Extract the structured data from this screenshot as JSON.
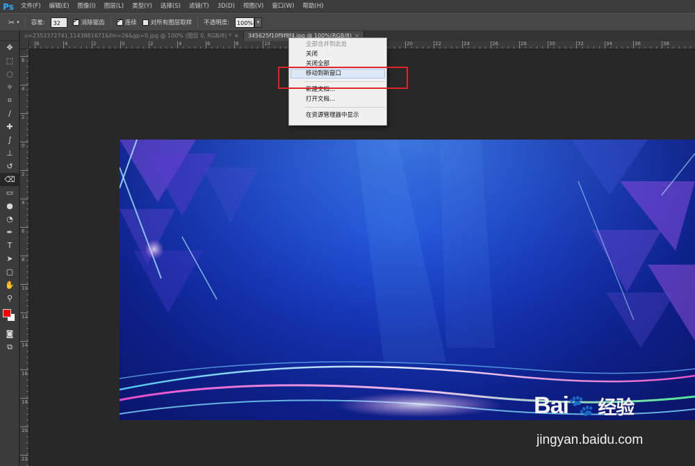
{
  "app": {
    "logo": "Ps",
    "menus": [
      "文件(F)",
      "编辑(E)",
      "图像(I)",
      "图层(L)",
      "类型(Y)",
      "选择(S)",
      "滤镜(T)",
      "3D(D)",
      "视图(V)",
      "窗口(W)",
      "帮助(H)"
    ]
  },
  "options": {
    "tolerance_label": "容差:",
    "tolerance_value": "32",
    "antialias_label": "消除锯齿",
    "contiguous_label": "连续",
    "sample_all_label": "对所有图层取样",
    "opacity_label": "不透明度:",
    "opacity_value": "100%"
  },
  "tabs": [
    {
      "label": "u=2353372741,1143881671&fm=26&gp=0.jpg @ 100% (图层 0, RGB/8) *",
      "close": "×",
      "active": false
    },
    {
      "label": "345625f10f9f8f4.jpg @ 100%(RGB/8)",
      "close": "×",
      "active": true
    }
  ],
  "ruler_top_labels": [
    "6",
    "4",
    "2",
    "0",
    "2",
    "4",
    "6",
    "8",
    "10",
    "12",
    "14",
    "16",
    "18",
    "20",
    "22",
    "24",
    "26",
    "28",
    "30",
    "32",
    "34",
    "36",
    "38"
  ],
  "ruler_left_labels": [
    "6",
    "4",
    "2",
    "0",
    "2",
    "4",
    "6",
    "8",
    "10",
    "12",
    "14",
    "16",
    "18",
    "20",
    "22"
  ],
  "context_menu": {
    "items": [
      {
        "label": "全部合并到此处",
        "disabled": true
      },
      {
        "label": "关闭",
        "disabled": false
      },
      {
        "label": "关闭全部",
        "disabled": false
      },
      {
        "label": "移动到新窗口",
        "disabled": false,
        "hover": true
      },
      {
        "label": "新建文档...",
        "disabled": false
      },
      {
        "label": "打开文档...",
        "disabled": false
      },
      {
        "label": "在资源管理器中显示",
        "disabled": false
      }
    ]
  },
  "colors": {
    "foreground": "#ff0000",
    "background": "#ffffff",
    "highlight": "#e0222a"
  },
  "watermark": {
    "logo": "Bai",
    "logo_cn": "经验",
    "url": "jingyan.baidu.com"
  }
}
